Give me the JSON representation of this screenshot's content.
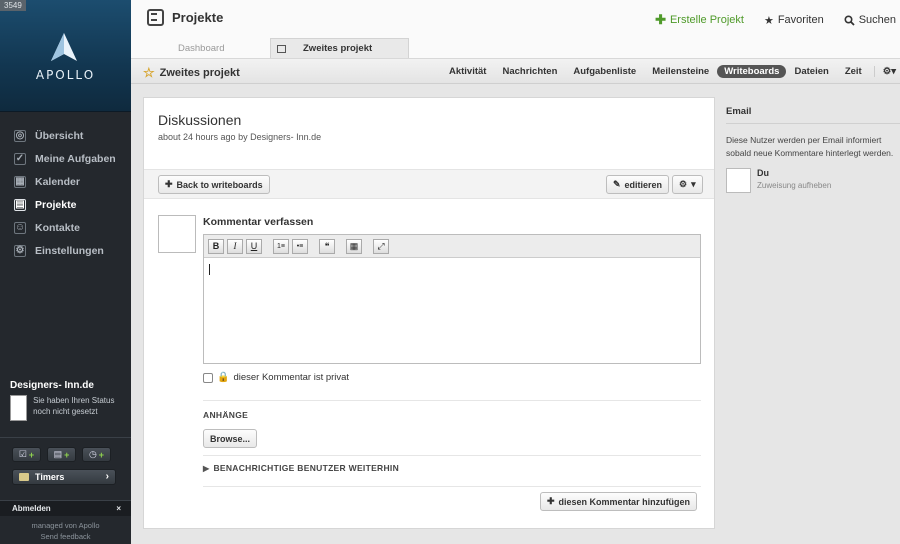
{
  "sidebar": {
    "build": "3549",
    "brand": "APOLLO",
    "nav": [
      {
        "label": "Übersicht",
        "icon": "overview-icon"
      },
      {
        "label": "Meine Aufgaben",
        "icon": "tasks-icon"
      },
      {
        "label": "Kalender",
        "icon": "calendar-icon"
      },
      {
        "label": "Projekte",
        "icon": "projects-icon",
        "active": true
      },
      {
        "label": "Kontakte",
        "icon": "contacts-icon"
      },
      {
        "label": "Einstellungen",
        "icon": "settings-icon"
      }
    ],
    "user": {
      "name": "Designers- Inn.de",
      "status": "Sie haben Ihren Status noch nicht gesetzt"
    },
    "timers_label": "Timers",
    "logout_label": "Abmelden",
    "logout_close": "×",
    "footer_line1": "managed von Apollo",
    "footer_line2": "Send feedback"
  },
  "header": {
    "title": "Projekte",
    "actions": {
      "create": "Erstelle Projekt",
      "favorites": "Favoriten",
      "search": "Suchen"
    }
  },
  "tabs": {
    "dashboard": "Dashboard",
    "project": "Zweites projekt"
  },
  "subnav": {
    "project_name": "Zweites projekt",
    "links": [
      "Aktivität",
      "Nachrichten",
      "Aufgabenliste",
      "Meilensteine",
      "Writeboards",
      "Dateien",
      "Zeit"
    ],
    "active": "Writeboards"
  },
  "main": {
    "title": "Diskussionen",
    "meta": "about 24 hours ago by Designers- Inn.de",
    "back_button": "Back to writeboards",
    "edit_button": "editieren",
    "compose_title": "Kommentar verfassen",
    "editor_buttons": [
      "B",
      "I",
      "U",
      "1≡",
      "•≡",
      "❝",
      "▦",
      "⤢"
    ],
    "private_label": "dieser Kommentar ist privat",
    "attachments_label": "ANHÄNGE",
    "browse_button": "Browse...",
    "notify_label": "BENACHRICHTIGE BENUTZER WEITERHIN",
    "submit_button": "diesen Kommentar hinzufügen"
  },
  "right_panel": {
    "heading": "Email",
    "description": "Diese Nutzer werden per Email informiert sobald neue Kommentare hinterlegt werden.",
    "recipient_name": "Du",
    "recipient_action": "Zuweisung aufheben"
  },
  "colors": {
    "sidebar_bg": "#24282d",
    "accent_green": "#4f9a2a",
    "active_pill": "#555555"
  }
}
